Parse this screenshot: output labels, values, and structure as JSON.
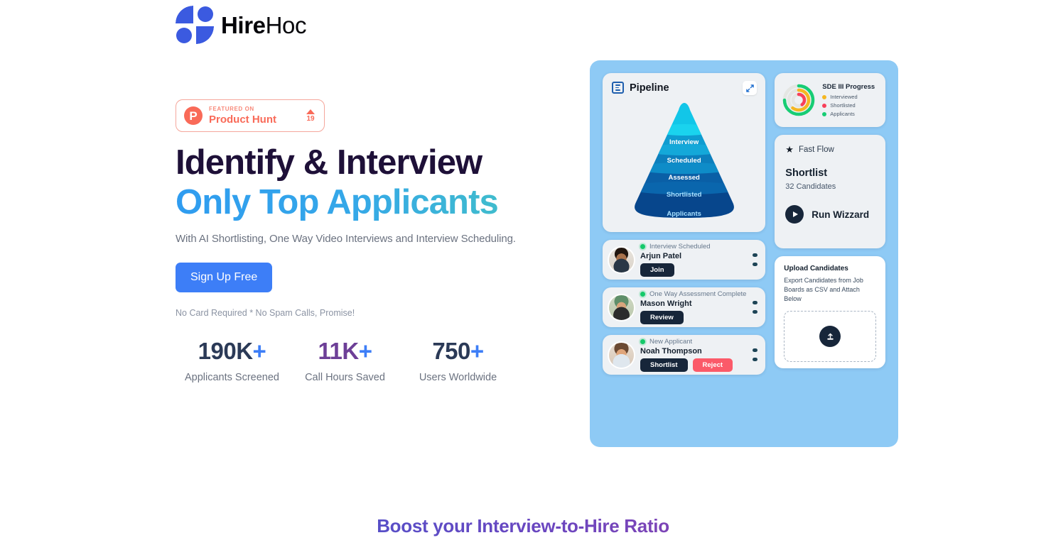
{
  "brand": {
    "name_bold": "Hire",
    "name_light": "Hoc",
    "logo_icon": "hirehoc-quadrant-logo",
    "accent_blue": "#3b5ae0"
  },
  "hero": {
    "badge": {
      "eyebrow": "FEATURED ON",
      "name": "Product Hunt",
      "logo_letter": "P",
      "upvote_count": "19",
      "color": "#f96a58"
    },
    "headline_line1": "Identify & Interview",
    "headline_line2": "Only Top Applicants",
    "subtitle": "With AI Shortlisting, One Way Video Interviews and Interview Scheduling.",
    "cta_label": "Sign Up Free",
    "cta_color": "#3d7ef7",
    "note": "No Card Required * No Spam Calls, Promise!",
    "stats": [
      {
        "value": "190K",
        "suffix": "+",
        "label": "Applicants Screened",
        "color": "#2b3a57"
      },
      {
        "value": "11K",
        "suffix": "+",
        "label": "Call Hours Saved",
        "color": "#6d3f97"
      },
      {
        "value": "750",
        "suffix": "+",
        "label": "Users Worldwide",
        "color": "#2b3a57"
      }
    ]
  },
  "dashboard": {
    "background_color": "#8ecaf5",
    "pipeline": {
      "title": "Pipeline",
      "icon": "document-list-icon",
      "expand_icon": "expand-diagonal-icon",
      "stages": [
        {
          "label": "Interview",
          "color": "#12c6e8"
        },
        {
          "label": "Scheduled",
          "color": "#0f9cd0"
        },
        {
          "label": "Assessed",
          "color": "#0c7fbd"
        },
        {
          "label": "Shortlisted",
          "color": "#0a5fa6"
        },
        {
          "label": "Applicants",
          "color": "#07468c"
        }
      ]
    },
    "candidates": [
      {
        "status": "Interview Scheduled",
        "name": "Arjun Patel",
        "avatar": "avatar-arjun-patel",
        "buttons": [
          {
            "label": "Join",
            "style": "dark"
          }
        ]
      },
      {
        "status": "One Way Assessment Complete",
        "name": "Mason Wright",
        "avatar": "avatar-mason-wright",
        "buttons": [
          {
            "label": "Review",
            "style": "dark"
          }
        ]
      },
      {
        "status": "New Applicant",
        "name": "Noah Thompson",
        "avatar": "avatar-noah-thompson",
        "buttons": [
          {
            "label": "Shortlist",
            "style": "dark"
          },
          {
            "label": "Reject",
            "style": "red"
          }
        ]
      }
    ],
    "progress": {
      "title": "SDE III Progress",
      "legend": [
        {
          "label": "Interviewed",
          "color": "#f5b722"
        },
        {
          "label": "Shortlisted",
          "color": "#f8405a"
        },
        {
          "label": "Applicants",
          "color": "#17cd74"
        }
      ]
    },
    "fast_flow": {
      "header": "Fast Flow",
      "star_icon": "star-icon",
      "title": "Shortlist",
      "subtitle": "32 Candidates",
      "run_label": "Run Wizzard",
      "play_icon": "play-icon"
    },
    "upload": {
      "title": "Upload Candidates",
      "description": "Export Candidates from Job Boards as CSV and Attach Below",
      "upload_icon": "upload-icon"
    }
  },
  "footer": {
    "heading": "Boost your Interview-to-Hire Ratio"
  }
}
